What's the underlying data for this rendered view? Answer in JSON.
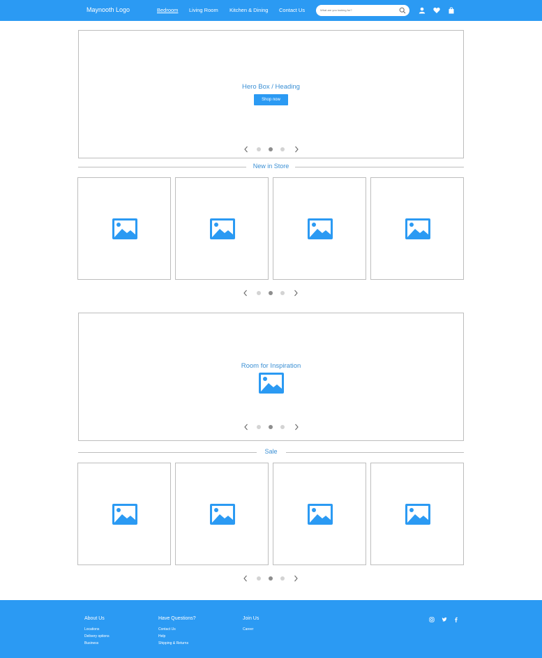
{
  "header": {
    "logo": "Maynooth Logo",
    "nav": [
      "Bedroom",
      "Living Room",
      "Kitchen & Dining",
      "Contact Us"
    ],
    "search_placeholder": "What are you looking for?",
    "icons": [
      "search-icon",
      "user-icon",
      "heart-icon",
      "bag-icon"
    ]
  },
  "hero": {
    "title": "Hero Box / Heading",
    "button": "Shop now"
  },
  "new_in_store": {
    "label": "New in Store",
    "cards": 4
  },
  "inspiration": {
    "title": "Room for Inspiration"
  },
  "sale": {
    "label": "Sale",
    "cards": 4
  },
  "pagination": {
    "active_dot": 2,
    "dots": 3
  },
  "footer": {
    "columns": [
      {
        "title": "About Us",
        "links": [
          "Locations",
          "Delivery options",
          "Business"
        ]
      },
      {
        "title": "Have Questions?",
        "links": [
          "Contact Us",
          "Help",
          "Shipping & Returns"
        ]
      },
      {
        "title": "Join Us",
        "links": [
          "Career"
        ]
      }
    ],
    "social": [
      "instagram-icon",
      "twitter-icon",
      "facebook-icon"
    ]
  },
  "colors": {
    "brand": "#2b9af3",
    "accent_text": "#3a8fd4"
  }
}
